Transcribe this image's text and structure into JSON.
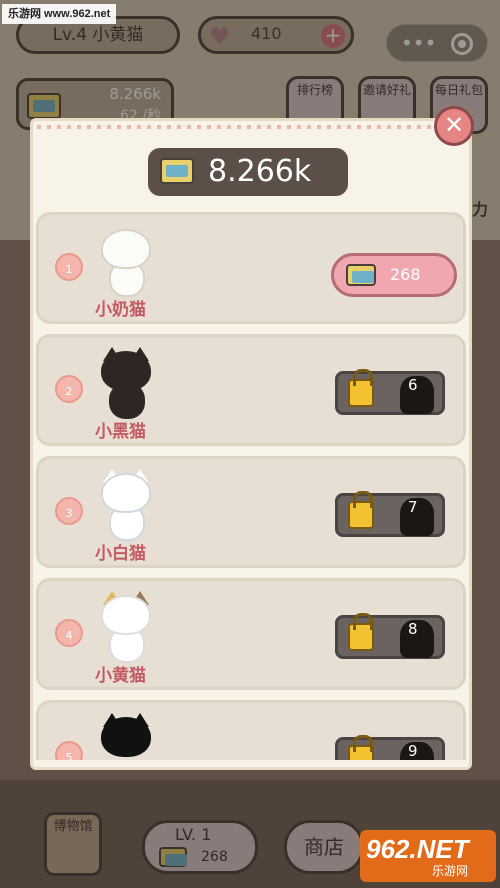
{
  "watermark_top": "乐游网 www.962.net",
  "header": {
    "level_label": "Lv.4 小黄猫",
    "hearts": "410",
    "coins_amount": "8.266k",
    "coins_rate": "62 /秒"
  },
  "top_buttons": [
    "排行榜",
    "邀请好礼",
    "每日礼包"
  ],
  "side_text": "力",
  "modal": {
    "total": "8.266k",
    "rows": [
      {
        "index": "1",
        "name": "小奶猫",
        "state": "buy",
        "price": "268"
      },
      {
        "index": "2",
        "name": "小黑猫",
        "state": "locked",
        "unlock_level": "6"
      },
      {
        "index": "3",
        "name": "小白猫",
        "state": "locked",
        "unlock_level": "7"
      },
      {
        "index": "4",
        "name": "小黄猫",
        "state": "locked",
        "unlock_level": "8"
      },
      {
        "index": "5",
        "name": "",
        "state": "locked",
        "unlock_level": "9"
      }
    ]
  },
  "bottom": {
    "museum": "博物馆",
    "level_label": "LV. 1",
    "level_cost": "268",
    "shop": "商店"
  },
  "watermark_bottom": {
    "big": "962.NET",
    "small": "乐游网"
  },
  "colors": {
    "accent_pink": "#f0a7b0",
    "name_red": "#c45a64",
    "close_red": "#e58684"
  }
}
